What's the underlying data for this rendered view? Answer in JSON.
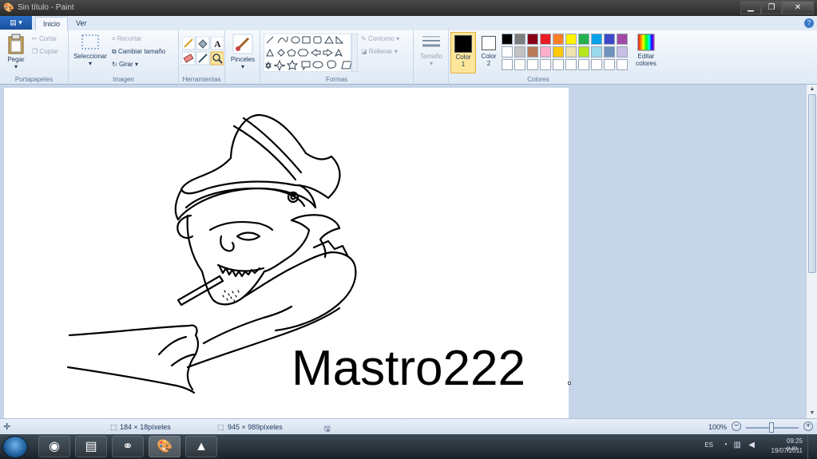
{
  "window": {
    "title": "Sin título - Paint",
    "app_icon": "paint-icon",
    "minimize": "▁",
    "maximize": "❐",
    "close": "✕"
  },
  "tabs": {
    "file_menu": "▤ ▾",
    "home": "Inicio",
    "view": "Ver"
  },
  "ribbon": {
    "clipboard": {
      "paste": "Pegar",
      "cut": "Cortar",
      "copy": "Copiar",
      "label": "Portapapeles"
    },
    "image": {
      "select": "Seleccionar",
      "crop": "Recortar",
      "resize": "Cambiar tamaño",
      "rotate": "Girar ▾",
      "label": "Imagen"
    },
    "tools": {
      "label": "Herramientas"
    },
    "brushes": {
      "label": "Pinceles"
    },
    "shapes": {
      "outline": "Contorno ▾",
      "fill": "Rellenar ▾",
      "label": "Formas"
    },
    "size": {
      "label": "Tamaño"
    },
    "colors": {
      "color1": "Color 1",
      "color2": "Color 2",
      "edit": "Editar colores",
      "label": "Colores",
      "color1_value": "#000000",
      "color2_value": "#ffffff",
      "palette": [
        "#000000",
        "#7f7f7f",
        "#880015",
        "#ed1c24",
        "#ff7f27",
        "#fff200",
        "#22b14c",
        "#00a2e8",
        "#3f48cc",
        "#a349a4",
        "#ffffff",
        "#c3c3c3",
        "#b97a57",
        "#ffaec9",
        "#ffc90e",
        "#efe4b0",
        "#b5e61d",
        "#99d9ea",
        "#7092be",
        "#c8bfe7",
        "#ffffff",
        "#ffffff",
        "#ffffff",
        "#ffffff",
        "#ffffff",
        "#ffffff",
        "#ffffff",
        "#ffffff",
        "#ffffff",
        "#ffffff"
      ]
    }
  },
  "canvas": {
    "text": "Mastro222"
  },
  "status": {
    "selection_size": "184 × 18píxeles",
    "image_size": "945 × 989píxeles",
    "zoom": "100%"
  },
  "tray": {
    "lang": "ES",
    "time": "09:25 p.m.",
    "date": "19/07/2011"
  }
}
